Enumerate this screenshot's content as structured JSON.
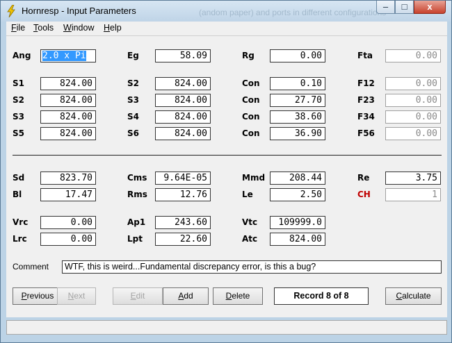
{
  "window": {
    "title": "Hornresp - Input Parameters",
    "background_title_text": "(andom paper) and ports in different configurations",
    "controls": {
      "minimize": "–",
      "maximize": "□",
      "close": "x"
    },
    "icon": "lightning-icon"
  },
  "menu": [
    {
      "accel": "F",
      "rest": "ile"
    },
    {
      "accel": "T",
      "rest": "ools"
    },
    {
      "accel": "W",
      "rest": "indow"
    },
    {
      "accel": "H",
      "rest": "elp"
    }
  ],
  "params": {
    "ang": {
      "label": "Ang",
      "value": "2.0 x Pi"
    },
    "eg": {
      "label": "Eg",
      "value": "58.09"
    },
    "rg": {
      "label": "Rg",
      "value": "0.00"
    },
    "fta": {
      "label": "Fta",
      "value": "0.00"
    },
    "s1": {
      "label": "S1",
      "value": "824.00"
    },
    "s2a": {
      "label": "S2",
      "value": "824.00"
    },
    "con1": {
      "label": "Con",
      "value": "0.10"
    },
    "f12": {
      "label": "F12",
      "value": "0.00"
    },
    "s2b": {
      "label": "S2",
      "value": "824.00"
    },
    "s3a": {
      "label": "S3",
      "value": "824.00"
    },
    "con2": {
      "label": "Con",
      "value": "27.70"
    },
    "f23": {
      "label": "F23",
      "value": "0.00"
    },
    "s3b": {
      "label": "S3",
      "value": "824.00"
    },
    "s4": {
      "label": "S4",
      "value": "824.00"
    },
    "con3": {
      "label": "Con",
      "value": "38.60"
    },
    "f34": {
      "label": "F34",
      "value": "0.00"
    },
    "s5": {
      "label": "S5",
      "value": "824.00"
    },
    "s6": {
      "label": "S6",
      "value": "824.00"
    },
    "con4": {
      "label": "Con",
      "value": "36.90"
    },
    "f56": {
      "label": "F56",
      "value": "0.00"
    },
    "sd": {
      "label": "Sd",
      "value": "823.70"
    },
    "cms": {
      "label": "Cms",
      "value": "9.64E-05"
    },
    "mmd": {
      "label": "Mmd",
      "value": "208.44"
    },
    "re": {
      "label": "Re",
      "value": "3.75"
    },
    "bl": {
      "label": "Bl",
      "value": "17.47"
    },
    "rms": {
      "label": "Rms",
      "value": "12.76"
    },
    "le": {
      "label": "Le",
      "value": "2.50"
    },
    "ch": {
      "label": "CH",
      "value": "1"
    },
    "vrc": {
      "label": "Vrc",
      "value": "0.00"
    },
    "ap1": {
      "label": "Ap1",
      "value": "243.60"
    },
    "vtc": {
      "label": "Vtc",
      "value": "109999.0"
    },
    "lrc": {
      "label": "Lrc",
      "value": "0.00"
    },
    "lpt": {
      "label": "Lpt",
      "value": "22.60"
    },
    "atc": {
      "label": "Atc",
      "value": "824.00"
    }
  },
  "comment": {
    "label": "Comment",
    "value": "WTF, this is weird...Fundamental discrepancy error, is this a bug?"
  },
  "buttons": {
    "previous": {
      "accel": "P",
      "rest": "revious"
    },
    "next": {
      "accel": "N",
      "rest": "ext"
    },
    "edit": {
      "accel": "E",
      "rest": "dit"
    },
    "add": {
      "accel": "A",
      "rest": "dd"
    },
    "delete": {
      "accel": "D",
      "rest": "elete"
    },
    "calculate": {
      "accel": "C",
      "rest": "alculate"
    }
  },
  "record": "Record 8 of 8",
  "colors": {
    "accent_red": "#c00000",
    "selection": "#3399ff"
  }
}
